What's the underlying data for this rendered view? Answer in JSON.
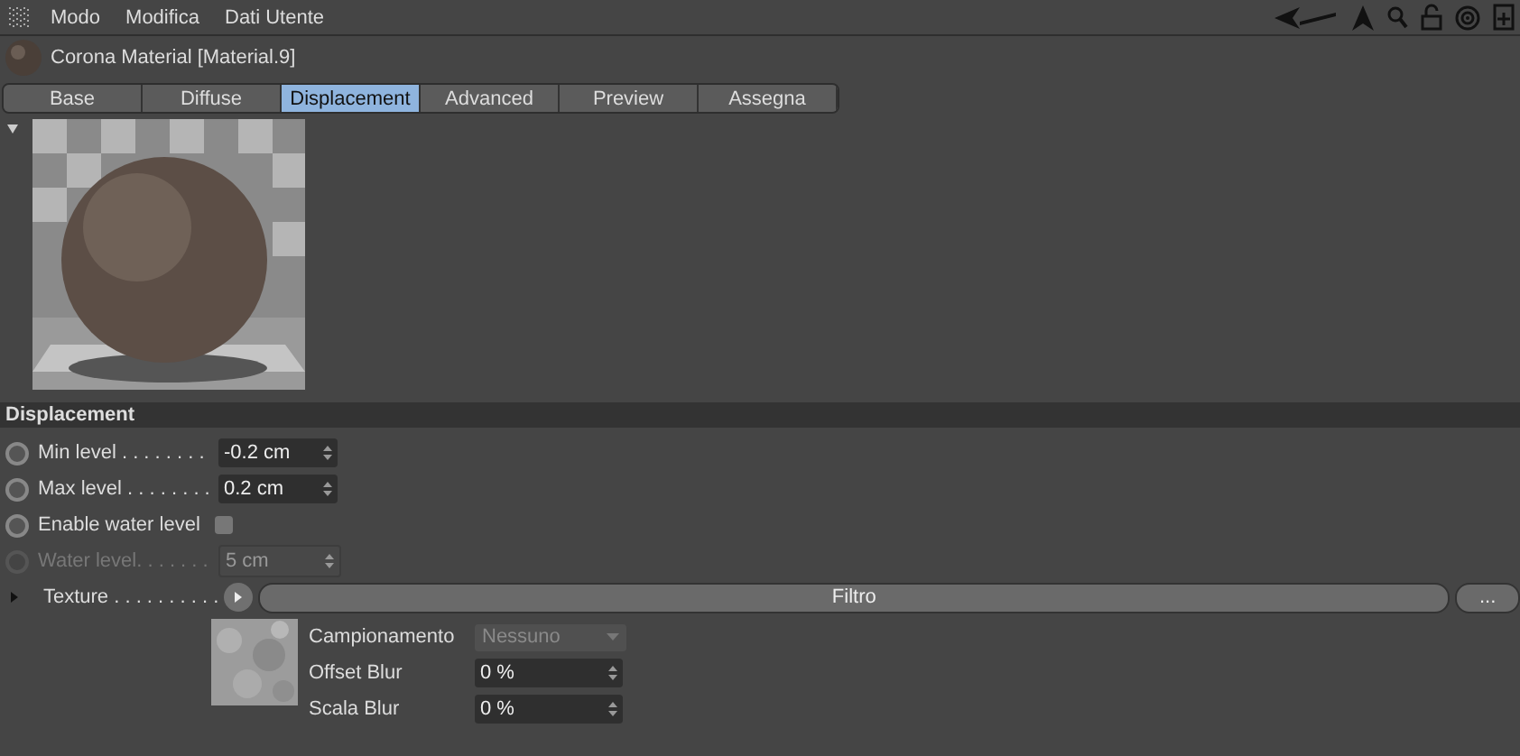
{
  "menu": [
    "Modo",
    "Modifica",
    "Dati Utente"
  ],
  "material": {
    "title": "Corona Material [Material.9]"
  },
  "tabs": [
    {
      "label": "Base",
      "selected": false
    },
    {
      "label": "Diffuse",
      "selected": false
    },
    {
      "label": "Displacement",
      "selected": true
    },
    {
      "label": "Advanced",
      "selected": false
    },
    {
      "label": "Preview",
      "selected": false
    },
    {
      "label": "Assegna",
      "selected": false
    }
  ],
  "section": {
    "title": "Displacement"
  },
  "params": [
    {
      "kind": "number",
      "label": "Min level . . . . . . . .",
      "value": "-0.2 cm",
      "disabled": false
    },
    {
      "kind": "number",
      "label": "Max level . . . . . . . .",
      "value": "0.2 cm",
      "disabled": false
    },
    {
      "kind": "checkbox",
      "label": "Enable water level",
      "checked": false,
      "disabled": false
    },
    {
      "kind": "number",
      "label": "Water level. . . . . . .",
      "value": "5 cm",
      "disabled": true
    }
  ],
  "texture": {
    "label": "Texture . . . . . . . . . .",
    "button": "Filtro",
    "more": "...",
    "options": [
      {
        "kind": "dropdown",
        "label": "Campionamento",
        "value": "Nessuno",
        "disabled": true
      },
      {
        "kind": "number",
        "label": "Offset Blur",
        "value": "0 %",
        "disabled": false
      },
      {
        "kind": "number",
        "label": "Scala Blur",
        "value": "0 %",
        "disabled": false
      }
    ]
  }
}
